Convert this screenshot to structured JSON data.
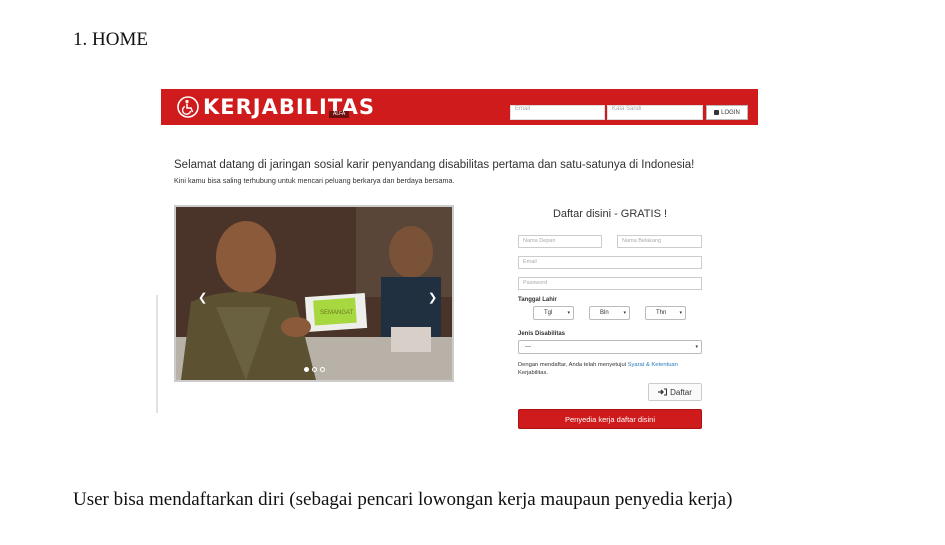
{
  "document": {
    "heading": "1. HOME",
    "caption": "User bisa mendaftarkan diri (sebagai pencari lowongan kerja maupaun penyedia kerja)"
  },
  "navbar": {
    "logo_text": "KERJABILITAS",
    "logo_badge": "ALFA",
    "email_placeholder": "Email",
    "password_placeholder": "Kata Sandi",
    "login_label": "LOGIN",
    "brand_color": "#cf1b1b"
  },
  "hero": {
    "welcome": "Selamat datang di jaringan sosial karir penyandang disabilitas pertama dan satu-satunya di Indonesia!",
    "subtitle": "Kini kamu bisa saling terhubung untuk mencari peluang berkarya dan berdaya bersama."
  },
  "carousel": {
    "slide_text": "SEMANGAT",
    "prev_icon": "chevron-left-icon",
    "next_icon": "chevron-right-icon",
    "slides_count": 3,
    "active_slide": 1
  },
  "form": {
    "title": "Daftar disini - GRATIS !",
    "first_name_placeholder": "Nama Depan",
    "last_name_placeholder": "Nama Belakang",
    "email_placeholder": "Email",
    "password_placeholder": "Password",
    "birthdate_label": "Tanggal Lahir",
    "day_select": "Tgl",
    "month_select": "Bln",
    "year_select": "Thn",
    "disability_label": "Jenis Disabilitas",
    "disability_select": "---",
    "terms_text": "Dengan mendaftar, Anda telah menyetujui",
    "terms_link": "Syarat & Ketentuan",
    "terms_suffix": "Kerjabilitas.",
    "register_label": "Daftar",
    "provider_label": "Penyedia kerja daftar disini"
  }
}
